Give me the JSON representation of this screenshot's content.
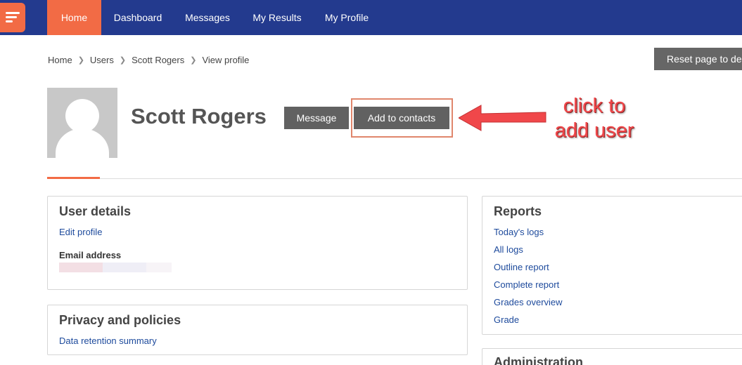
{
  "nav": {
    "items": [
      {
        "label": "Home"
      },
      {
        "label": "Dashboard"
      },
      {
        "label": "Messages"
      },
      {
        "label": "My Results"
      },
      {
        "label": "My Profile"
      }
    ]
  },
  "breadcrumb": [
    "Home",
    "Users",
    "Scott Rogers",
    "View profile"
  ],
  "reset_button": "Reset page to de",
  "profile": {
    "name": "Scott Rogers",
    "message_button": "Message",
    "add_contacts_button": "Add to contacts"
  },
  "annotation": {
    "line1": "click to",
    "line2": "add user",
    "color": "#f0474a"
  },
  "user_details": {
    "title": "User details",
    "edit_link": "Edit profile",
    "email_label": "Email address"
  },
  "privacy": {
    "title": "Privacy and policies",
    "link": "Data retention summary"
  },
  "reports": {
    "title": "Reports",
    "links": [
      "Today's logs",
      "All logs",
      "Outline report",
      "Complete report",
      "Grades overview",
      "Grade"
    ]
  },
  "administration": {
    "title": "Administration"
  },
  "colors": {
    "navbar": "#233a8e",
    "accent": "#f26b45",
    "button": "#616161",
    "link": "#1d4a9c"
  }
}
